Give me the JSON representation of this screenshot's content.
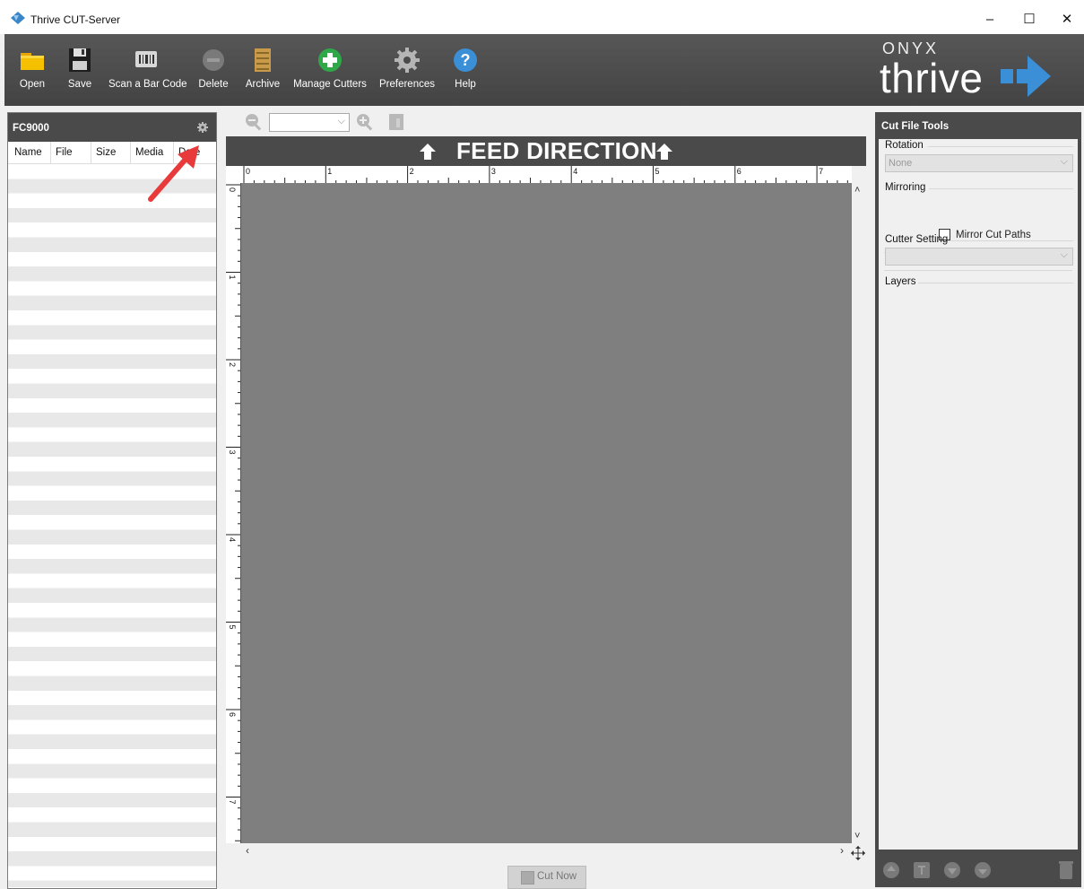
{
  "window": {
    "title": "Thrive CUT-Server",
    "minimize_glyph": "–",
    "maximize_glyph": "☐",
    "close_glyph": "✕"
  },
  "toolbar": {
    "items": [
      {
        "label": "Open",
        "icon": "folder-icon"
      },
      {
        "label": "Save",
        "icon": "floppy-disk-icon"
      },
      {
        "label": "Scan a Bar Code",
        "icon": "barcode-scanner-icon"
      },
      {
        "label": "Delete",
        "icon": "delete-icon"
      },
      {
        "label": "Archive",
        "icon": "archive-icon"
      },
      {
        "label": "Manage Cutters",
        "icon": "add-circle-icon"
      },
      {
        "label": "Preferences",
        "icon": "gear-icon"
      },
      {
        "label": "Help",
        "icon": "help-icon"
      }
    ],
    "accent_green": "#33b24a",
    "accent_blue": "#3a8fd6"
  },
  "brand": {
    "top": "ONYX",
    "name": "thrive"
  },
  "left_panel": {
    "title": "FC9000",
    "columns": [
      "Name",
      "File",
      "Size",
      "Media",
      "Date"
    ]
  },
  "canvas": {
    "feed_direction": "FEED DIRECTION",
    "ruler_unit": "in",
    "ruler_top_labels": [
      "0",
      "1",
      "2",
      "3",
      "4",
      "5",
      "6",
      "7"
    ],
    "ruler_left_labels": [
      "0",
      "1",
      "2",
      "3",
      "4",
      "5",
      "6",
      "7"
    ],
    "cut_now_label": "Cut Now"
  },
  "right_panel": {
    "title": "Cut File Tools",
    "rotation_label": "Rotation",
    "rotation_value": "None",
    "mirroring_label": "Mirroring",
    "mirror_checkbox_label": "Mirror Cut Paths",
    "mirror_checked": false,
    "cutter_setting_label": "Cutter Setting",
    "cutter_setting_value": "",
    "layers_label": "Layers"
  },
  "annotation": {
    "arrow_color": "#e83a3a"
  }
}
